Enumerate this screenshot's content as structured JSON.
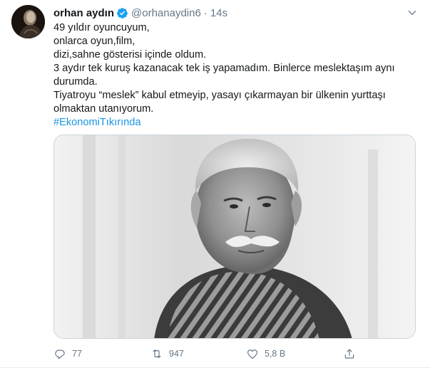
{
  "tweet": {
    "author": {
      "display_name": "orhan aydın",
      "handle": "@orhanaydin6",
      "verified": true
    },
    "time": "14s",
    "separator": "·",
    "lines": [
      "49 yıldır oyuncuyum,",
      "onlarca oyun,film,",
      "dizi,sahne gösterisi içinde oldum.",
      "3 aydır tek kuruş kazanacak tek iş yapamadım. Binlerce meslektaşım aynı",
      "durumda.",
      "Tiyatroyu “meslek” kabul etmeyip, yasayı çıkarmayan bir ülkenin yurttaşı",
      "olmaktan utanıyorum."
    ],
    "hashtag": "#EkonomiTıkırında",
    "media": {
      "kind": "photo",
      "style": "black-and-white portrait"
    },
    "actions": {
      "reply_count": "77",
      "retweet_count": "947",
      "like_count": "5,8 B",
      "share_count": ""
    }
  },
  "icons": {
    "verified": "verified-badge-icon",
    "caret": "chevron-down-icon",
    "reply": "reply-icon",
    "retweet": "retweet-icon",
    "like": "heart-icon",
    "share": "share-icon"
  },
  "colors": {
    "text": "#14171a",
    "secondary": "#657786",
    "link": "#1b95e0",
    "verified": "#1da1f2",
    "border": "#e6ecf0"
  }
}
